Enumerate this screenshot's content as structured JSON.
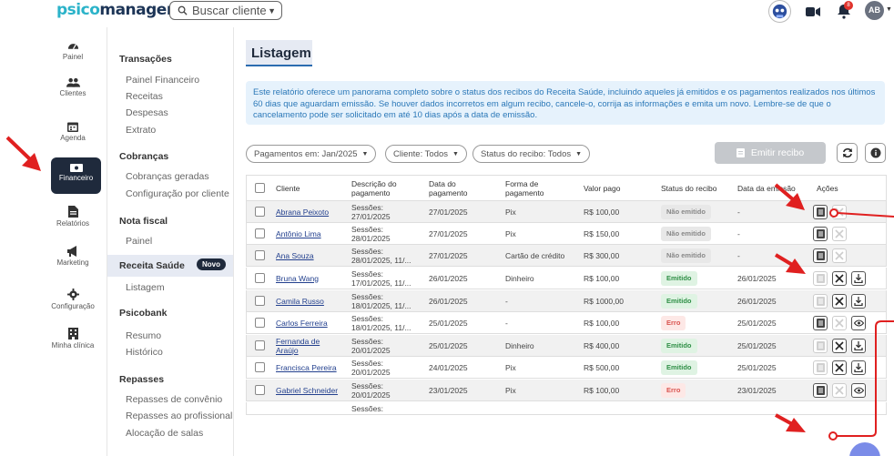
{
  "app": {
    "logo_part1": "psico",
    "logo_part2": "manager",
    "search_placeholder": "Buscar cliente",
    "avatar": "AB",
    "notifications": "8"
  },
  "rail": [
    {
      "label": "Painel",
      "icon": "gauge-icon"
    },
    {
      "label": "Clientes",
      "icon": "users-icon"
    },
    {
      "label": "Agenda",
      "icon": "calendar-icon"
    },
    {
      "label": "Financeiro",
      "icon": "money-icon",
      "active": true
    },
    {
      "label": "Relatórios",
      "icon": "report-icon"
    },
    {
      "label": "Marketing",
      "icon": "megaphone-icon"
    },
    {
      "label": "Configuração",
      "icon": "gear-icon"
    },
    {
      "label": "Minha clínica",
      "icon": "building-icon"
    }
  ],
  "submenu": {
    "transacoes": {
      "heading": "Transações",
      "items": [
        "Painel Financeiro",
        "Receitas",
        "Despesas",
        "Extrato"
      ]
    },
    "cobrancas": {
      "heading": "Cobranças",
      "items": [
        "Cobranças geradas",
        "Configuração por cliente"
      ]
    },
    "nota_fiscal": {
      "heading": "Nota fiscal",
      "items": [
        "Painel"
      ]
    },
    "receita_saude": {
      "heading": "Receita Saúde",
      "badge": "Novo",
      "items": [
        "Listagem"
      ]
    },
    "psicobank": {
      "heading": "Psicobank",
      "items": [
        "Resumo",
        "Histórico"
      ]
    },
    "repasses": {
      "heading": "Repasses",
      "items": [
        "Repasses de convênio",
        "Repasses ao profissional",
        "Alocação de salas"
      ]
    }
  },
  "main": {
    "title": "Listagem",
    "info": "Este relatório oferece um panorama completo sobre o status dos recibos do Receita Saúde, incluindo aqueles já emitidos e os pagamentos realizados nos últimos 60 dias que aguardam emissão. Se houver dados incorretos em algum recibo, cancele-o, corrija as informações e emita um novo. Lembre-se de que o cancelamento pode ser solicitado em até 10 dias após a data de emissão.",
    "filters": {
      "payments": "Pagamentos em: Jan/2025",
      "client": "Cliente: Todos",
      "status": "Status do recibo: Todos"
    },
    "emit_button": "Emitir recibo"
  },
  "table": {
    "columns": [
      "Cliente",
      "Descrição do pagamento",
      "Data do pagamento",
      "Forma de pagamento",
      "Valor pago",
      "Status do recibo",
      "Data da emissão",
      "Ações"
    ],
    "rows": [
      {
        "cliente": "Abrana Peixoto",
        "desc": [
          "Sessões:",
          "27/01/2025"
        ],
        "data": "27/01/2025",
        "forma": "Pix",
        "valor": "R$ 100,00",
        "status": "Não emitido",
        "st": "ne",
        "emissao": "-",
        "acoes": "ne"
      },
      {
        "cliente": "Antônio Lima",
        "desc": [
          "Sessões:",
          "28/01/2025"
        ],
        "data": "27/01/2025",
        "forma": "Pix",
        "valor": "R$ 150,00",
        "status": "Não emitido",
        "st": "ne",
        "emissao": "-",
        "acoes": "ne"
      },
      {
        "cliente": "Ana Souza",
        "desc": [
          "Sessões:",
          "28/01/2025, 11/..."
        ],
        "data": "27/01/2025",
        "forma": "Cartão de crédito",
        "valor": "R$ 300,00",
        "status": "Não emitido",
        "st": "ne",
        "emissao": "-",
        "acoes": "ne"
      },
      {
        "cliente": "Bruna Wang",
        "desc": [
          "Sessões:",
          "17/01/2025, 11/..."
        ],
        "data": "26/01/2025",
        "forma": "Dinheiro",
        "valor": "R$ 100,00",
        "status": "Emitido",
        "st": "em",
        "emissao": "26/01/2025",
        "acoes": "em"
      },
      {
        "cliente": "Camila Russo",
        "desc": [
          "Sessões:",
          "18/01/2025, 11/..."
        ],
        "data": "26/01/2025",
        "forma": "-",
        "valor": "R$ 1000,00",
        "status": "Emitido",
        "st": "em",
        "emissao": "26/01/2025",
        "acoes": "em"
      },
      {
        "cliente": "Carlos Ferreira",
        "desc": [
          "Sessões:",
          "18/01/2025, 11/..."
        ],
        "data": "25/01/2025",
        "forma": "-",
        "valor": "R$ 100,00",
        "status": "Erro",
        "st": "er",
        "emissao": "25/01/2025",
        "acoes": "er"
      },
      {
        "cliente": [
          "Fernanda de",
          "Araújo"
        ],
        "desc": [
          "Sessões:",
          "20/01/2025"
        ],
        "data": "25/01/2025",
        "forma": "Dinheiro",
        "valor": "R$ 400,00",
        "status": "Emitido",
        "st": "em",
        "emissao": "25/01/2025",
        "acoes": "em"
      },
      {
        "cliente": "Francisca Pereira",
        "desc": [
          "Sessões:",
          "20/01/2025"
        ],
        "data": "24/01/2025",
        "forma": "Pix",
        "valor": "R$ 500,00",
        "status": "Emitido",
        "st": "em",
        "emissao": "25/01/2025",
        "acoes": "em"
      },
      {
        "cliente": "Gabriel Schneider",
        "desc": [
          "Sessões:",
          "20/01/2025"
        ],
        "data": "23/01/2025",
        "forma": "Pix",
        "valor": "R$ 100,00",
        "status": "Erro",
        "st": "er",
        "emissao": "23/01/2025",
        "acoes": "er"
      },
      {
        "cliente": "",
        "desc": [
          "Sessões:",
          ""
        ],
        "data": "",
        "forma": "",
        "valor": "",
        "status": "",
        "st": "",
        "emissao": "",
        "acoes": ""
      }
    ]
  },
  "colors": {
    "navy": "#1f2a3c",
    "accent": "#2b6cb0",
    "info_bg": "#e6f2fc",
    "annotation_red": "#e02020"
  }
}
